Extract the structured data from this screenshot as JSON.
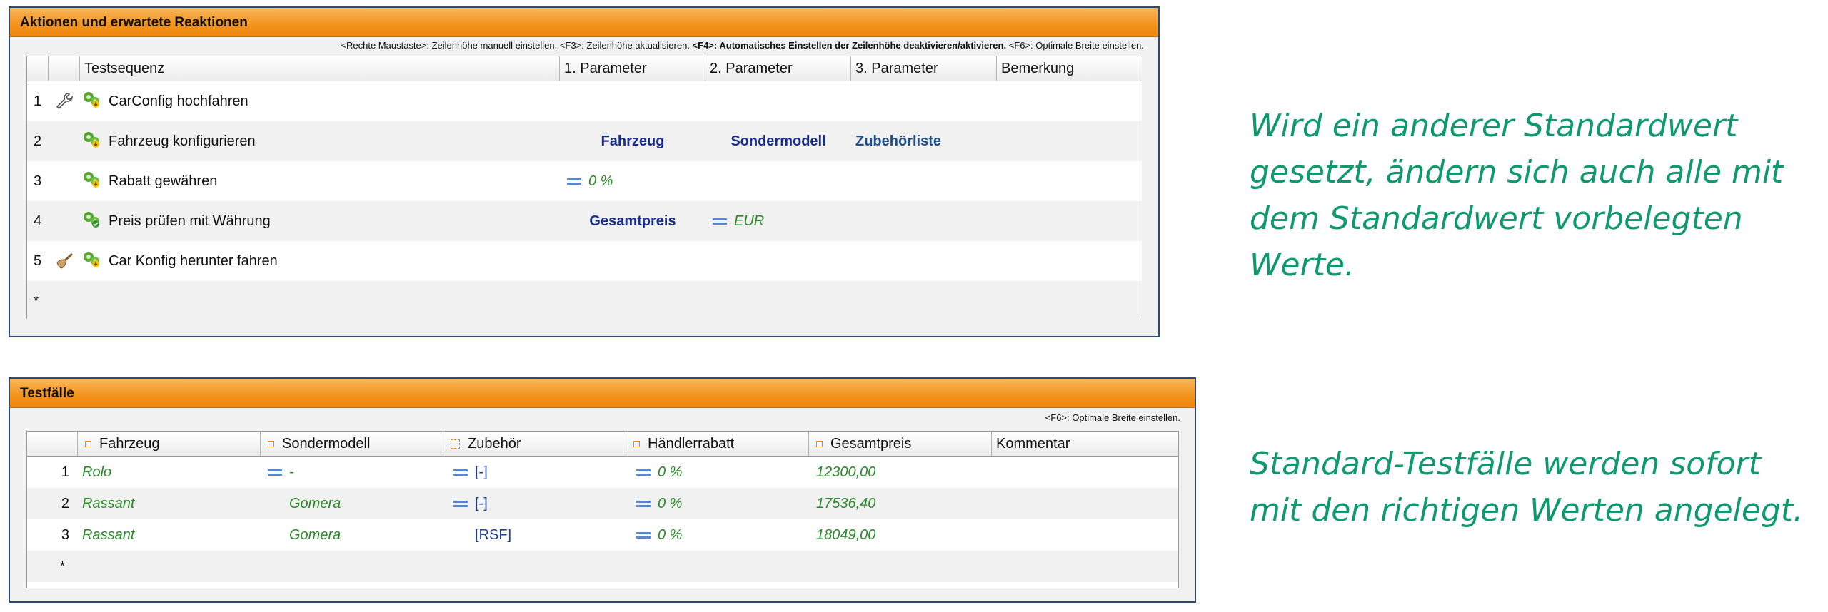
{
  "panel1": {
    "title": "Aktionen und erwartete Reaktionen",
    "hint_a": "<Rechte Maustaste>: Zeilenhöhe manuell einstellen. <F3>: Zeilenhöhe aktualisieren. ",
    "hint_b": "<F4>: Automatisches Einstellen der Zeilenhöhe deaktivieren/aktivieren.",
    "hint_c": " <F6>: Optimale Breite einstellen.",
    "columns": [
      "Testsequenz",
      "1. Parameter",
      "2. Parameter",
      "3. Parameter",
      "Bemerkung"
    ],
    "rows": [
      {
        "num": "1",
        "prefix_icon": "wrench-icon",
        "name": "CarConfig hochfahren",
        "p1": "",
        "p2": "",
        "p3": ""
      },
      {
        "num": "2",
        "prefix_icon": "",
        "name": "Fahrzeug konfigurieren",
        "p1": "Fahrzeug",
        "p2": "Sondermodell",
        "p3": "Zubehörliste"
      },
      {
        "num": "3",
        "prefix_icon": "",
        "name": "Rabatt gewähren",
        "p1": "0 %",
        "p2": "",
        "p3": ""
      },
      {
        "num": "4",
        "prefix_icon": "",
        "name": "Preis prüfen mit Währung",
        "p1": "Gesamtpreis",
        "p2": "EUR",
        "p3": ""
      },
      {
        "num": "5",
        "prefix_icon": "broom-icon",
        "name": "Car Konfig herunter fahren",
        "p1": "",
        "p2": "",
        "p3": ""
      }
    ],
    "new_row": "*"
  },
  "panel2": {
    "title": "Testfälle",
    "hint": "<F6>: Optimale Breite einstellen.",
    "columns": [
      "Fahrzeug",
      "Sondermodell",
      "Zubehör",
      "Händlerrabatt",
      "Gesamtpreis",
      "Kommentar"
    ],
    "rows": [
      {
        "num": "1",
        "fahrzeug": "Rolo",
        "sondermodell": "-",
        "zubehoer": "[-]",
        "rabatt": "0 %",
        "preis": "12300,00"
      },
      {
        "num": "2",
        "fahrzeug": "Rassant",
        "sondermodell": "Gomera",
        "zubehoer": "[-]",
        "rabatt": "0 %",
        "preis": "17536,40"
      },
      {
        "num": "3",
        "fahrzeug": "Rassant",
        "sondermodell": "Gomera",
        "zubehoer": "[RSF]",
        "rabatt": "0 %",
        "preis": "18049,00"
      }
    ],
    "new_row": "*"
  },
  "side": {
    "text1": "Wird ein anderer Standardwert gesetzt, ändern sich auch alle mit dem Standardwert vorbelegten Werte.",
    "text2": "Standard-Testfälle werden sofort mit den richtigen Werten angelegt."
  },
  "colors": {
    "header_orange": "#f2931b",
    "param_blue": "#1a2f8c",
    "value_green": "#2a8a28",
    "side_text": "#0f9a6a",
    "frame": "#2b4a78"
  }
}
